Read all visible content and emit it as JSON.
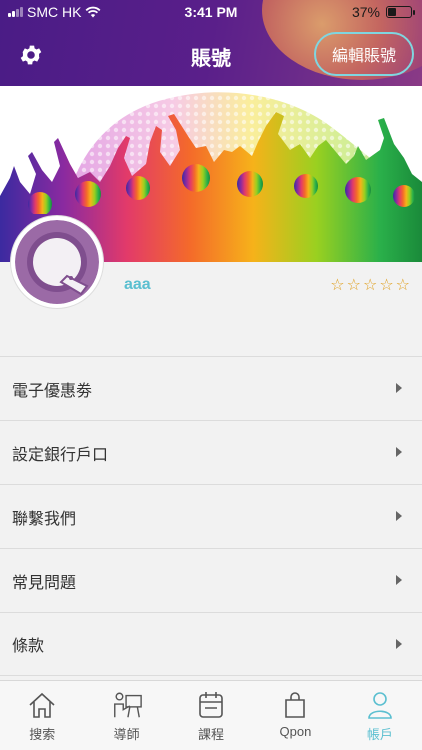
{
  "status_bar": {
    "carrier": "SMC HK",
    "time": "3:41 PM",
    "battery_percent": "37%",
    "battery_level": 0.37
  },
  "header": {
    "title": "賬號",
    "edit_label": "編輯賬號"
  },
  "profile": {
    "username": "aaa",
    "rating": 0,
    "rating_max": 5
  },
  "menu": {
    "items": [
      {
        "label": "電子優惠劵"
      },
      {
        "label": "設定銀行戶口"
      },
      {
        "label": "聯繫我們"
      },
      {
        "label": "常見問題"
      },
      {
        "label": "條款"
      }
    ]
  },
  "tabbar": {
    "tabs": [
      {
        "label": "搜索",
        "icon": "home-icon"
      },
      {
        "label": "導師",
        "icon": "tutor-icon"
      },
      {
        "label": "課程",
        "icon": "calendar-icon"
      },
      {
        "label": "Qpon",
        "icon": "shopping-bag-icon"
      },
      {
        "label": "帳戶",
        "icon": "person-icon"
      }
    ],
    "active_index": 4
  },
  "colors": {
    "accent": "#5bbfd0",
    "header_purple": "#4a1c86",
    "star": "#e0a020"
  }
}
